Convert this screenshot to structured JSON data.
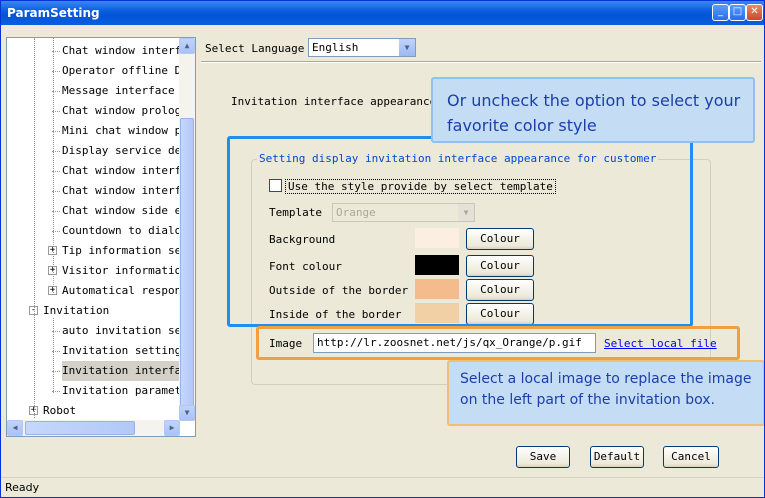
{
  "window": {
    "title": "ParamSetting",
    "min_glyph": "_",
    "max_glyph": "□",
    "close_glyph": "✕"
  },
  "tree": {
    "items": [
      {
        "label": "Chat window interfac",
        "level": 2,
        "expander": ""
      },
      {
        "label": "Operator offline Dis",
        "level": 2,
        "expander": ""
      },
      {
        "label": "Message interface se",
        "level": 2,
        "expander": ""
      },
      {
        "label": "Chat window prologue",
        "level": 2,
        "expander": ""
      },
      {
        "label": "Mini chat window pro",
        "level": 2,
        "expander": ""
      },
      {
        "label": "Display service depa",
        "level": 2,
        "expander": ""
      },
      {
        "label": "Chat window interfac",
        "level": 2,
        "expander": ""
      },
      {
        "label": "Chat window interfac",
        "level": 2,
        "expander": ""
      },
      {
        "label": "Chat window side edg",
        "level": 2,
        "expander": ""
      },
      {
        "label": "Countdown to dialog",
        "level": 2,
        "expander": ""
      },
      {
        "label": "Tip information sett",
        "level": 2,
        "expander": "+"
      },
      {
        "label": "Visitor information",
        "level": 2,
        "expander": "+"
      },
      {
        "label": "Automatical response",
        "level": 2,
        "expander": "+"
      },
      {
        "label": "Invitation",
        "level": 1,
        "expander": "-"
      },
      {
        "label": "auto invitation sett",
        "level": 2,
        "expander": ""
      },
      {
        "label": "Invitation setting",
        "level": 2,
        "expander": ""
      },
      {
        "label": "Invitation interface",
        "level": 2,
        "expander": "",
        "selected": true
      },
      {
        "label": "Invitation parameter",
        "level": 2,
        "expander": ""
      },
      {
        "label": "Robot",
        "level": 1,
        "expander": "+"
      }
    ],
    "scroll_up": "▲",
    "scroll_down": "▼",
    "scroll_left": "◀",
    "scroll_right": "▶"
  },
  "language": {
    "label": "Select Language",
    "value": "English",
    "arrow": "▼"
  },
  "section": {
    "heading": "Invitation interface appearance se"
  },
  "group": {
    "title": "Setting display invitation interface appearance for customer",
    "checkbox_label": "Use the style provide by select template",
    "checkbox_checked": false,
    "template_label": "Template",
    "template_value": "Orange",
    "template_arrow": "▼",
    "rows": [
      {
        "label": "Background",
        "color": "#fcefe2",
        "button": "Colour"
      },
      {
        "label": "Font colour",
        "color": "#000000",
        "button": "Colour"
      },
      {
        "label": "Outside of the border",
        "color": "#f4bb8d",
        "button": "Colour"
      },
      {
        "label": "Inside of the border",
        "color": "#f0d0a4",
        "button": "Colour"
      }
    ],
    "image_label": "Image",
    "image_value": "http://lr.zoosnet.net/js/qx_Orange/p.gif",
    "image_link": "Select local file"
  },
  "callouts": {
    "top": {
      "line1": "Or uncheck the option to select your",
      "line2": "favorite color style"
    },
    "bottom": {
      "line1": "Select a local image to replace the image",
      "line2": "on the left part of the invitation box."
    }
  },
  "buttons": {
    "save": "Save",
    "default": "Default",
    "cancel": "Cancel"
  },
  "status": {
    "text": "Ready"
  },
  "colors": {
    "callout_blue_border": "#1e8ff0",
    "callout_orange_border": "#f0a040",
    "callout_fill": "#c5dcf5",
    "callout_text": "#1a3fa8"
  }
}
